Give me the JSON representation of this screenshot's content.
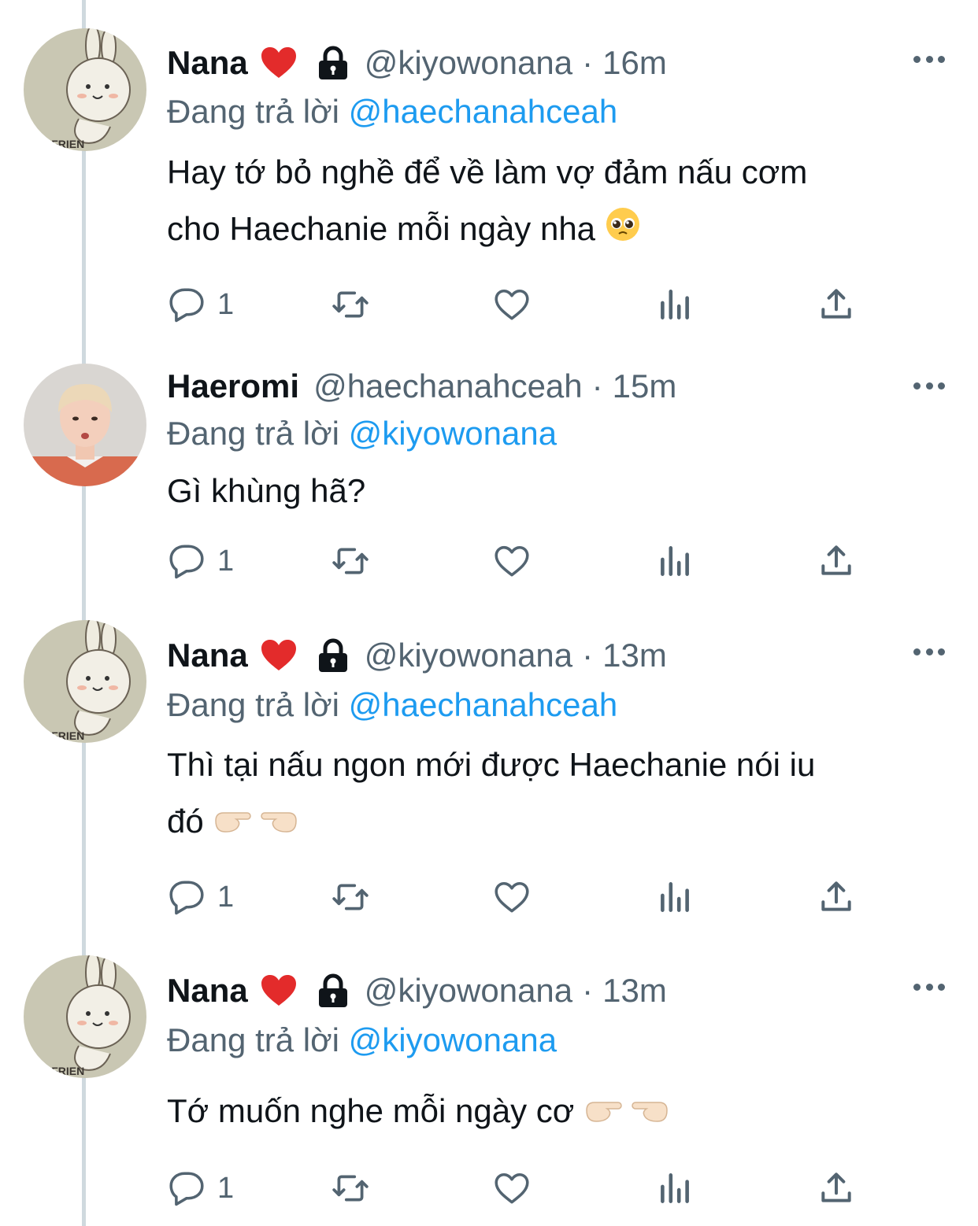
{
  "colors": {
    "text": "#0f1419",
    "secondary": "#536471",
    "mention": "#1d9bf0",
    "thread_line": "#cfd9de"
  },
  "tweets": [
    {
      "name": "Nana",
      "heart_icon": "red-heart-emoji",
      "lock_icon": "lock-icon",
      "handle": "@kiyowonana",
      "separator": "·",
      "time": "16m",
      "reply_prefix": "Đang trả lời",
      "reply_handle": "@haechanahceah",
      "lines": [
        "Hay tớ bỏ nghề để về làm vợ đảm nấu cơm",
        "cho Haechanie mỗi ngày nha"
      ],
      "trailing_emoji": "pleading-face-emoji",
      "reply_count": "1"
    },
    {
      "name": "Haeromi",
      "handle": "@haechanahceah",
      "separator": "·",
      "time": "15m",
      "reply_prefix": "Đang trả lời",
      "reply_handle": "@kiyowonana",
      "lines": [
        "Gì khùng hã?"
      ],
      "reply_count": "1"
    },
    {
      "name": "Nana",
      "heart_icon": "red-heart-emoji",
      "lock_icon": "lock-icon",
      "handle": "@kiyowonana",
      "separator": "·",
      "time": "13m",
      "reply_prefix": "Đang trả lời",
      "reply_handle": "@haechanahceah",
      "lines": [
        "Thì tại nấu ngon mới được Haechanie nói iu",
        "đó"
      ],
      "trailing_emoji": "pointing-fingers-emoji",
      "reply_count": "1"
    },
    {
      "name": "Nana",
      "heart_icon": "red-heart-emoji",
      "lock_icon": "lock-icon",
      "handle": "@kiyowonana",
      "separator": "·",
      "time": "13m",
      "reply_prefix": "Đang trả lời",
      "reply_handle": "@kiyowonana",
      "lines": [
        "Tớ muốn nghe mỗi ngày cơ"
      ],
      "trailing_emoji": "pointing-fingers-emoji",
      "reply_count": "1"
    }
  ],
  "action_icons": [
    "reply-icon",
    "retweet-icon",
    "like-icon",
    "views-icon",
    "share-icon"
  ]
}
